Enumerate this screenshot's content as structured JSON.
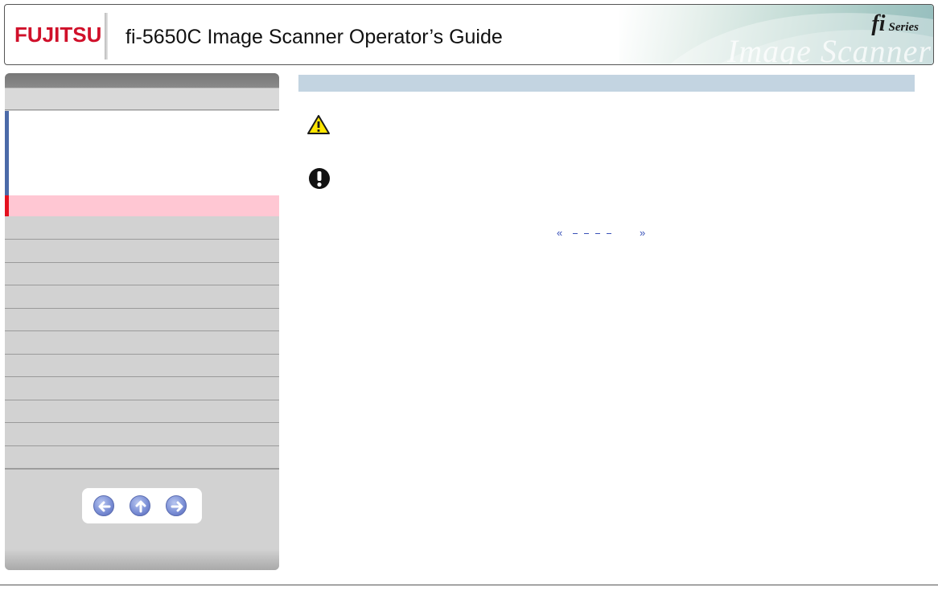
{
  "header": {
    "logo_text": "FUJITSU",
    "title": "fi-5650C Image Scanner Operator’s Guide",
    "series_mark": "fi",
    "series_word": "Series",
    "banner_text": "Image Scanner"
  },
  "sidebar": {
    "active_accent_color": "#e4101e",
    "sub_accent_color": "#4b6aa8",
    "nav_buttons": [
      "previous-page",
      "up",
      "next-page"
    ]
  },
  "main": {
    "page_nav": {
      "prev_glyph": "«",
      "next_glyph": "»"
    }
  },
  "colors": {
    "brand_red": "#d0102a",
    "head_bar": "#c3d4e1",
    "link_blue": "#3a52b8"
  }
}
